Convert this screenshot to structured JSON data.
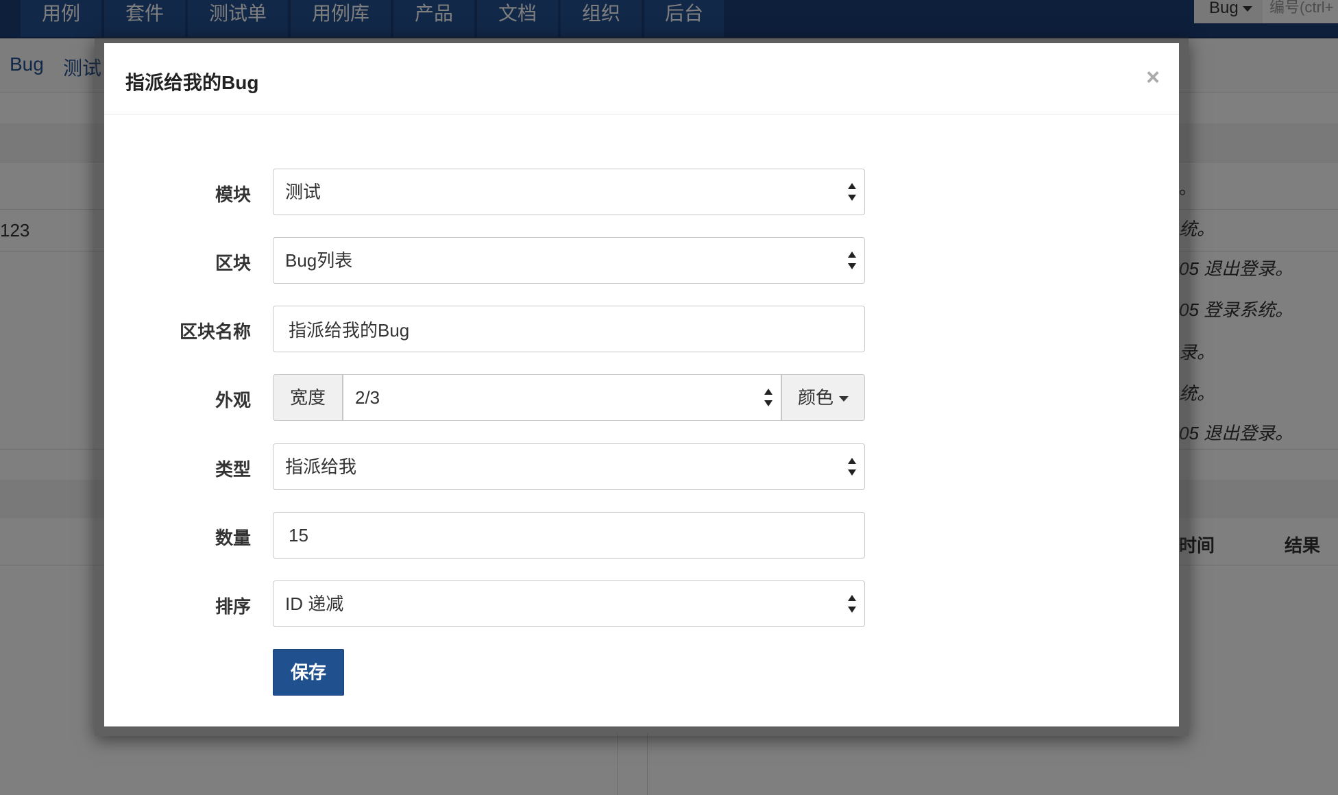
{
  "topnav": {
    "tabs": [
      "用例",
      "套件",
      "测试单",
      "用例库",
      "产品",
      "文档",
      "组织",
      "后台"
    ],
    "search_type": "Bug",
    "search_placeholder": "编号(ctrl+"
  },
  "subnav": {
    "links": [
      "Bug",
      "测试"
    ]
  },
  "background": {
    "left_value": "123",
    "right_lines": [
      "。",
      "统。",
      "05 退出登录。",
      "05 登录系统。",
      "录。",
      "统。",
      "05 退出登录。"
    ],
    "table_headers": [
      "时间",
      "结果"
    ]
  },
  "modal": {
    "title": "指派给我的Bug",
    "close": "×",
    "fields": {
      "module": {
        "label": "模块",
        "value": "测试"
      },
      "block": {
        "label": "区块",
        "value": "Bug列表"
      },
      "block_name": {
        "label": "区块名称",
        "value": "指派给我的Bug"
      },
      "appearance": {
        "label": "外观",
        "width_addon": "宽度",
        "width_value": "2/3",
        "color_button": "颜色"
      },
      "type": {
        "label": "类型",
        "value": "指派给我"
      },
      "count": {
        "label": "数量",
        "value": "15"
      },
      "order": {
        "label": "排序",
        "value": "ID 递减"
      }
    },
    "save": "保存"
  },
  "colors": {
    "nav_bg": "#1d3f78",
    "tab_bg": "#245091",
    "primary_button": "#21508f",
    "overlay": "rgba(0,0,0,0.5)"
  }
}
